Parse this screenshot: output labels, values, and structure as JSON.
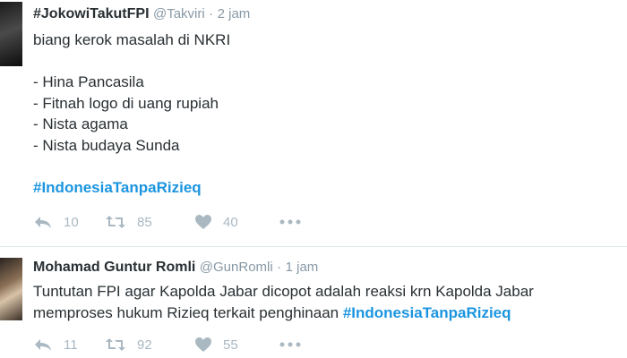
{
  "tweets": [
    {
      "name": "#JokowiTakutFPI",
      "handle": "@Takviri",
      "separator": "·",
      "time": "2 jam",
      "text": "biang kerok masalah di NKRI\n\n- Hina Pancasila\n- Fitnah logo di uang rupiah\n- Nista agama\n- Nista budaya Sunda\n\n",
      "hashtag": "#IndonesiaTanpaRizieq",
      "replies": "10",
      "retweets": "85",
      "likes": "40"
    },
    {
      "name": "Mohamad Guntur Romli",
      "handle": "@GunRomli",
      "separator": "·",
      "time": "1 jam",
      "text": "Tuntutan FPI agar Kapolda Jabar dicopot adalah reaksi krn Kapolda Jabar\nmemproses hukum Rizieq terkait penghinaan ",
      "hashtag": "#IndonesiaTanpaRizieq",
      "replies": "11",
      "retweets": "92",
      "likes": "55"
    }
  ],
  "icons": {
    "reply": "reply-icon",
    "retweet": "retweet-icon",
    "like": "heart-icon",
    "more": "more-icon"
  },
  "colors": {
    "hashtag": "#1b95e0",
    "muted": "#8899a6",
    "action": "#aab8c2",
    "text": "#292f33"
  }
}
